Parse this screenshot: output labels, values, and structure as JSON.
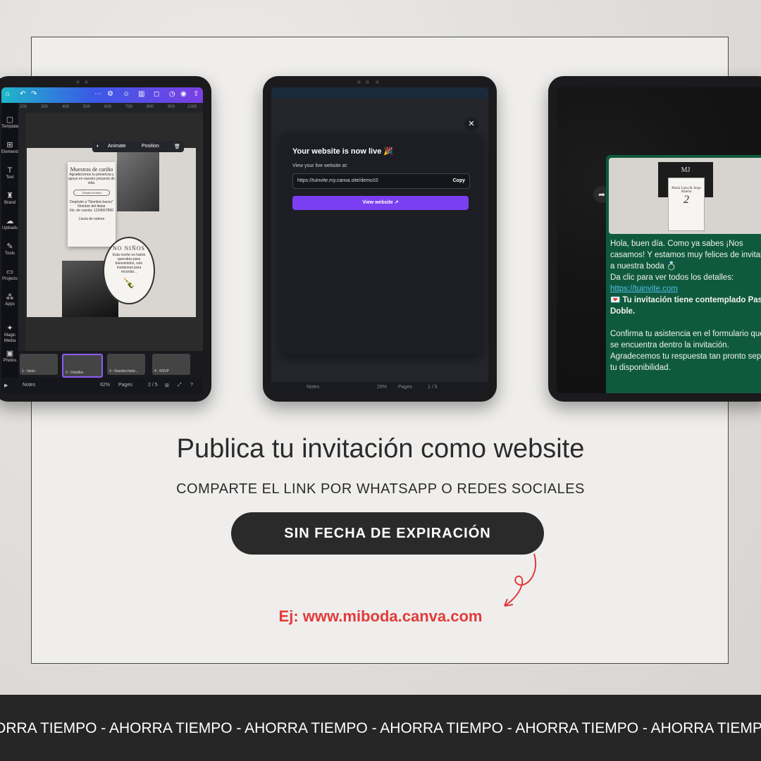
{
  "tablet1": {
    "toolbar": {
      "animate": "Animate",
      "position": "Position"
    },
    "ruler": [
      "200",
      "300",
      "400",
      "500",
      "600",
      "700",
      "800",
      "900",
      "1000"
    ],
    "sidebar": [
      "Templates",
      "Elements",
      "Text",
      "Brand",
      "Uploads",
      "Tools",
      "Projects",
      "Apps",
      "Magic Media",
      "Photos"
    ],
    "card": {
      "heading": "Muestras de cariño",
      "body": "Agradecemos tu presencia y apoyo en nuestro proyecto de vida.",
      "pill": "Tienda en línea",
      "deposit": "Depósito a \"Nombre banco\"",
      "holder": "Nombre del titular",
      "account": "No. de cuenta: 1234567890",
      "envelope": "Lluvia de sobres"
    },
    "oval": {
      "heading": "NO NIÑOS",
      "body": "Esta noche no habrá querubes para bienvenidos, solo mariposas para recordar..."
    },
    "thumbs": [
      "1 - Inicio",
      "2 - Detalles",
      "3 - Nuestra histo...",
      "4 - RSVP"
    ],
    "bottom": {
      "notes": "Notes",
      "zoom": "62%",
      "pages": "Pages",
      "page_count": "2 / 5"
    }
  },
  "tablet2": {
    "modal": {
      "title": "Your website is now live 🎉",
      "subtitle": "View your live website at:",
      "url": "https://tuinvite.my.canva.site/demo10",
      "copy": "Copy",
      "view": "View website ↗"
    },
    "bottom": {
      "notes": "Notes",
      "zoom": "29%",
      "pages": "Pages",
      "page_count": "1 / 5"
    }
  },
  "tablet3": {
    "message": {
      "p1": "Hola, buen día. Como ya sabes ¡Nos casamos! Y estamos muy felices de invitarlos a nuestra boda 💍",
      "p2": "Da clic para ver todos los detalles:",
      "link": "https://tuinvite.com",
      "p3": "💌 Tu invitación tiene contemplado Pase Doble.",
      "p4": "Confirma tu asistencia en el formulario que se encuentra dentro la invitación. Agradecemos tu respuesta tan pronto sepas tu disponibilidad."
    },
    "invite": {
      "monogram": "MJ",
      "names": "María Luisa & Jorge Alberto",
      "day": "2"
    }
  },
  "headline": "Publica tu invitación como website",
  "subline": "COMPARTE EL LINK POR WHATSAPP O REDES SOCIALES",
  "button": "SIN FECHA DE EXPIRACIÓN",
  "example": "Ej: www.miboda.canva.com",
  "banner": "ORRA TIEMPO - AHORRA TIEMPO - AHORRA TIEMPO - AHORRA TIEMPO - AHORRA TIEMPO - AHORRA TIEMPO - AHORRA TIEMPO",
  "colors": {
    "accent_red": "#e23b3b",
    "dark": "#2a2a2a",
    "whatsapp_green": "#0f5a3e",
    "canva_purple": "#7b3ff2"
  }
}
